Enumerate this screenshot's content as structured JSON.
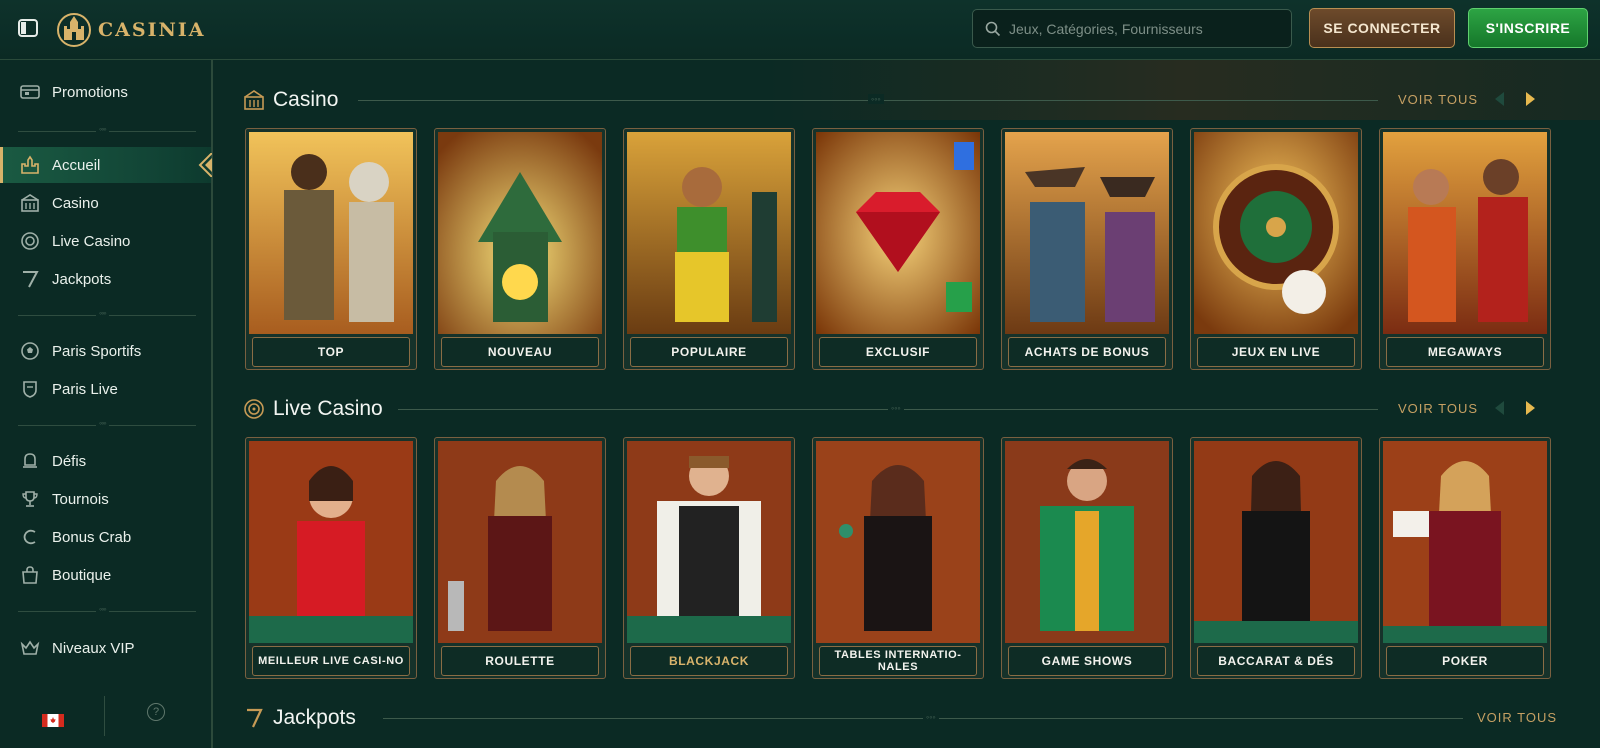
{
  "header": {
    "brand": "CASINIA",
    "search_placeholder": "Jeux, Catégories, Fournisseurs",
    "login_label": "SE CONNECTER",
    "signup_label": "S'INSCRIRE"
  },
  "sidebar": {
    "items": [
      {
        "label": "Promotions",
        "icon": "promotions-icon"
      },
      {
        "label": "Accueil",
        "icon": "home-castle-icon",
        "active": true
      },
      {
        "label": "Casino",
        "icon": "casino-icon"
      },
      {
        "label": "Live Casino",
        "icon": "live-casino-icon"
      },
      {
        "label": "Jackpots",
        "icon": "seven-icon"
      },
      {
        "label": "Paris Sportifs",
        "icon": "soccer-ball-icon"
      },
      {
        "label": "Paris Live",
        "icon": "shield-icon"
      },
      {
        "label": "Défis",
        "icon": "challenges-icon"
      },
      {
        "label": "Tournois",
        "icon": "trophy-icon"
      },
      {
        "label": "Bonus Crab",
        "icon": "claw-icon"
      },
      {
        "label": "Boutique",
        "icon": "shop-icon"
      },
      {
        "label": "Niveaux VIP",
        "icon": "crown-icon"
      }
    ],
    "footer": {
      "help": "?"
    }
  },
  "sections": {
    "casino": {
      "title": "Casino",
      "see_all": "VOIR TOUS",
      "cards": [
        "TOP",
        "NOUVEAU",
        "POPULAIRE",
        "EXCLUSIF",
        "ACHATS DE BONUS",
        "JEUX EN LIVE",
        "MEGAWAYS"
      ]
    },
    "live_casino": {
      "title": "Live Casino",
      "see_all": "VOIR TOUS",
      "cards": [
        "MEILLEUR LIVE CASI-NO",
        "ROULETTE",
        "BLACKJACK",
        "TABLES INTERNATIO-NALES",
        "GAME SHOWS",
        "BACCARAT & DÉS",
        "POKER"
      ]
    },
    "jackpots": {
      "title": "Jackpots",
      "see_all": "VOIR TOUS"
    }
  },
  "colors": {
    "background": "#0b2a24",
    "gold": "#d8b36a",
    "signup_green": "#2da444",
    "login_brown": "#6d4a2b"
  }
}
